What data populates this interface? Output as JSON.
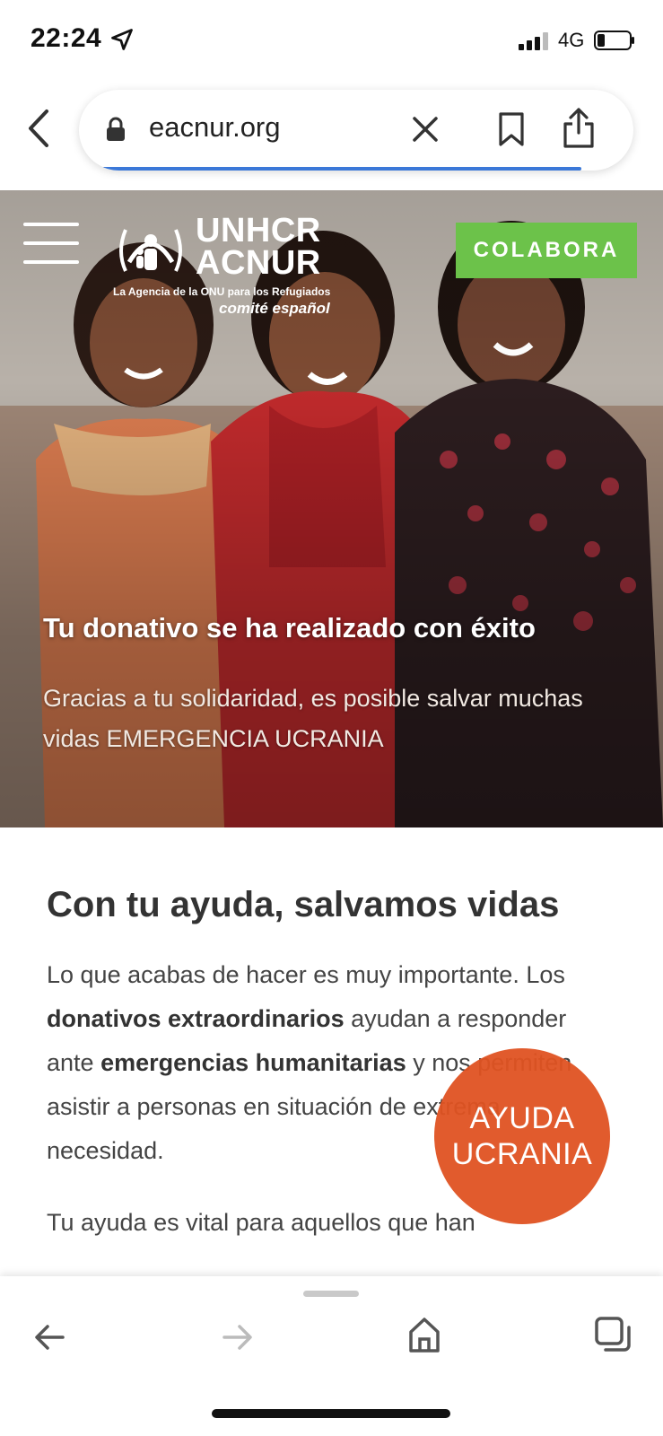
{
  "status_bar": {
    "time": "22:24",
    "network": "4G"
  },
  "browser": {
    "url": "eacnur.org"
  },
  "header": {
    "logo_line1": "UNHCR",
    "logo_line2": "ACNUR",
    "logo_tagline": "La Agencia de la ONU para los Refugiados",
    "logo_committee": "comité español",
    "cta_label": "COLABORA",
    "cta_color": "#6cc24a"
  },
  "hero": {
    "title": "Tu donativo se ha realizado con éxito",
    "subtitle": "Gracias a tu solidaridad, es posible salvar muchas vidas EMERGENCIA UCRANIA"
  },
  "content": {
    "heading": "Con tu ayuda, salvamos vidas",
    "p1_a": "Lo que acabas de hacer es muy importante. Los ",
    "p1_b": "donativos extraordinarios",
    "p1_c": " ayudan a responder ante ",
    "p1_d": "emergencias humanitarias",
    "p1_e": " y nos permiten asistir a personas en situación de extrema necesidad.",
    "p2": "Tu ayuda es vital para aquellos que han"
  },
  "badge": {
    "line1": "AYUDA",
    "line2": "UCRANIA",
    "color": "#e05322"
  },
  "toolbar": {
    "icons": [
      "back-arrow-icon",
      "forward-arrow-icon",
      "home-icon",
      "tabs-icon"
    ]
  }
}
